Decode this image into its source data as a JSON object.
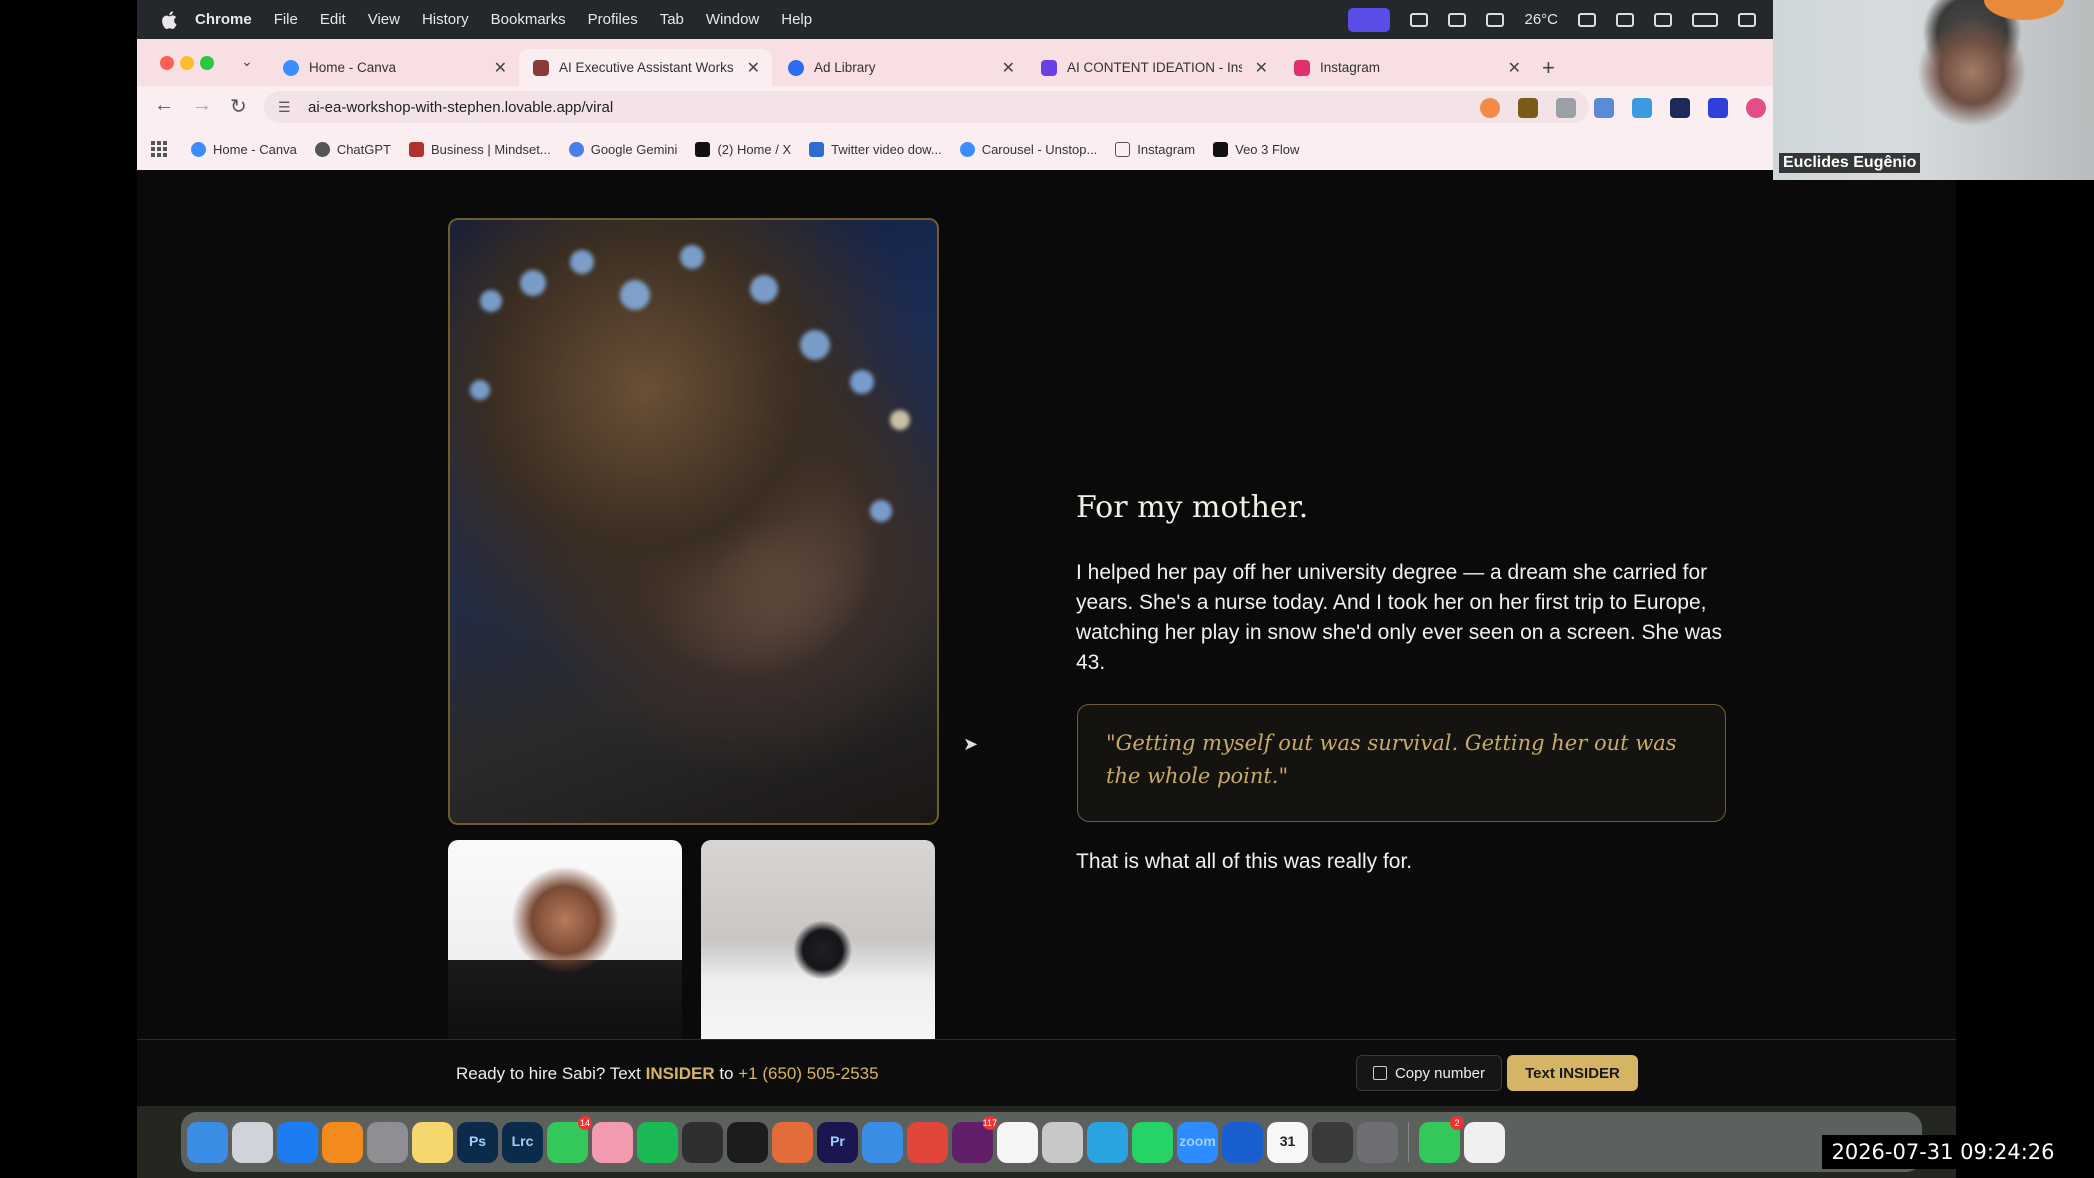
{
  "menubar": {
    "app": "Chrome",
    "menus": [
      "File",
      "Edit",
      "View",
      "History",
      "Bookmarks",
      "Profiles",
      "Tab",
      "Window",
      "Help"
    ],
    "weather": "26°C"
  },
  "tabs": [
    {
      "label": "Home - Canva",
      "icon": "canva-icon",
      "color": "#3c8cff",
      "active": false
    },
    {
      "label": "AI Executive Assistant Works",
      "icon": "site-icon",
      "color": "#8b3a3a",
      "active": true
    },
    {
      "label": "Ad Library",
      "icon": "meta-icon",
      "color": "#2d6cf0",
      "active": false
    },
    {
      "label": "AI CONTENT IDEATION - Inst",
      "icon": "bookmark-icon",
      "color": "#6b3fe8",
      "active": false
    },
    {
      "label": "Instagram",
      "icon": "instagram-icon",
      "color": "#e1306c",
      "active": false
    }
  ],
  "address_bar": {
    "url": "ai-ea-workshop-with-stephen.lovable.app/viral"
  },
  "bookmarks": [
    {
      "label": "Home - Canva",
      "color": "#3c8cff"
    },
    {
      "label": "ChatGPT",
      "color": "#555555"
    },
    {
      "label": "Business | Mindset...",
      "color": "#b33030"
    },
    {
      "label": "Google Gemini",
      "color": "#4a7ee8"
    },
    {
      "label": "(2) Home / X",
      "color": "#111111"
    },
    {
      "label": "Twitter video dow...",
      "color": "#2b6ed1"
    },
    {
      "label": "Carousel - Unstop...",
      "color": "#3c8cff"
    },
    {
      "label": "Instagram",
      "color": "#666666"
    },
    {
      "label": "Veo 3 Flow",
      "color": "#111111"
    }
  ],
  "content": {
    "heading": "For my mother.",
    "body": "I helped her pay off her university degree — a dream she carried for years. She's a nurse today. And I took her on her first trip to Europe, watching her play in snow she'd only ever seen on a screen. She was 43.",
    "quote": "\"Getting myself out was survival. Getting her out was the whole point.\"",
    "closing": "That is what all of this was really for."
  },
  "cta": {
    "prefix": "Ready to hire Sabi? Text ",
    "keyword": "INSIDER",
    "middle": " to ",
    "phone": "+1 (650) 505-2535",
    "copy_label": "Copy number",
    "text_label": "Text INSIDER"
  },
  "webcam": {
    "name": "Euclides Eugênio"
  },
  "clock": "2026-07-31 09:24:26",
  "dock": {
    "apps": [
      {
        "name": "finder-icon",
        "color": "#3a8ee6"
      },
      {
        "name": "launchpad-icon",
        "color": "#d0d4da"
      },
      {
        "name": "app-store-icon",
        "color": "#1e7cf2"
      },
      {
        "name": "books-icon",
        "color": "#f28a1e"
      },
      {
        "name": "settings-icon",
        "color": "#8e8e93"
      },
      {
        "name": "notes-icon",
        "color": "#f5d76e"
      },
      {
        "name": "photoshop-icon",
        "color": "#0c2a4a",
        "text": "Ps"
      },
      {
        "name": "lightroom-icon",
        "color": "#0c2a4a",
        "text": "Lrc"
      },
      {
        "name": "messages-icon",
        "color": "#34c759",
        "badge": "14"
      },
      {
        "name": "photos-icon",
        "color": "#f29ab0"
      },
      {
        "name": "spotify-icon",
        "color": "#1db954"
      },
      {
        "name": "chatgpt-icon",
        "color": "#2f2f2f"
      },
      {
        "name": "perplexity-icon",
        "color": "#1c1c1c"
      },
      {
        "name": "claude-icon",
        "color": "#e36c3a"
      },
      {
        "name": "premiere-icon",
        "color": "#1b1550",
        "text": "Pr"
      },
      {
        "name": "safari-icon",
        "color": "#3a8ee6"
      },
      {
        "name": "chrome-icon",
        "color": "#e0463a"
      },
      {
        "name": "slack-icon",
        "color": "#611f69",
        "badge": "117"
      },
      {
        "name": "monday-icon",
        "color": "#f5f5f5"
      },
      {
        "name": "backup-icon",
        "color": "#c8c8c8"
      },
      {
        "name": "telegram-icon",
        "color": "#2aa4e0"
      },
      {
        "name": "whatsapp-icon",
        "color": "#25d366"
      },
      {
        "name": "zoom-icon",
        "color": "#2d8cff",
        "text": "zoom"
      },
      {
        "name": "onepassword-icon",
        "color": "#1a5fd1"
      },
      {
        "name": "calendar-icon",
        "color": "#f7f7f7",
        "text": "31"
      },
      {
        "name": "calculator-icon",
        "color": "#3a3a3a"
      },
      {
        "name": "iphone-mirroring-icon",
        "color": "#6e6e73"
      },
      {
        "name": "facetime-icon",
        "color": "#34c759",
        "badge": "2"
      },
      {
        "name": "textedit-icon",
        "color": "#f0f0f0"
      }
    ]
  }
}
